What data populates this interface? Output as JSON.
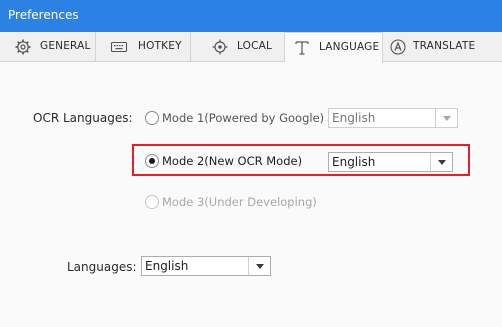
{
  "window": {
    "title": "Preferences"
  },
  "tabs": [
    {
      "label": "GENERAL",
      "icon": "gear-icon"
    },
    {
      "label": "HOTKEY",
      "icon": "keyboard-icon"
    },
    {
      "label": "LOCAL",
      "icon": "location-icon"
    },
    {
      "label": "LANGUAGE",
      "icon": "text-t-icon",
      "active": true
    },
    {
      "label": "TRANSLATE",
      "icon": "translate-a-icon"
    }
  ],
  "ocr": {
    "label": "OCR Languages:",
    "modes": [
      {
        "label": "Mode 1(Powered by Google)",
        "selected": false,
        "enabled": true,
        "language": "English"
      },
      {
        "label": "Mode 2(New OCR Mode)",
        "selected": true,
        "enabled": true,
        "language": "English"
      },
      {
        "label": "Mode 3(Under Developing)",
        "selected": false,
        "enabled": false
      }
    ]
  },
  "languages": {
    "label": "Languages:",
    "value": "English"
  },
  "colors": {
    "titlebar": "#2b82e4",
    "highlight": "#e2202c"
  }
}
